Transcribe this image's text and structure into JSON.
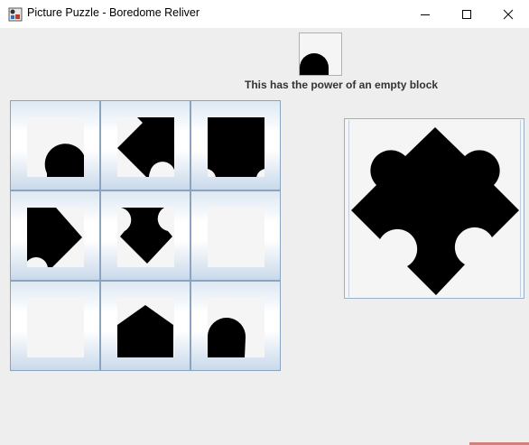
{
  "window": {
    "title": "Picture Puzzle - Boredome Reliver",
    "icon": "puzzle-app-icon",
    "controls": [
      "minimize-icon",
      "maximize-icon",
      "close-icon"
    ]
  },
  "empty_block": {
    "caption": "This has the power of an empty block"
  },
  "grid": {
    "rows": 3,
    "cols": 3,
    "tiles": [
      {
        "id": 1,
        "piece": "circle-bottom-right"
      },
      {
        "id": 2,
        "piece": "diamond-top-right"
      },
      {
        "id": 3,
        "piece": "square-top"
      },
      {
        "id": 4,
        "piece": "diamond-left"
      },
      {
        "id": 5,
        "piece": "diamond-center"
      },
      {
        "id": 6,
        "piece": "blank"
      },
      {
        "id": 7,
        "piece": "blank"
      },
      {
        "id": 8,
        "piece": "house-bottom"
      },
      {
        "id": 9,
        "piece": "circle-bottom-left"
      }
    ]
  },
  "preview": {
    "shape": "puzzle-piece"
  },
  "colors": {
    "fill": "#000000",
    "background": "#eeeeee",
    "tile_border": "#8aa4c0"
  }
}
